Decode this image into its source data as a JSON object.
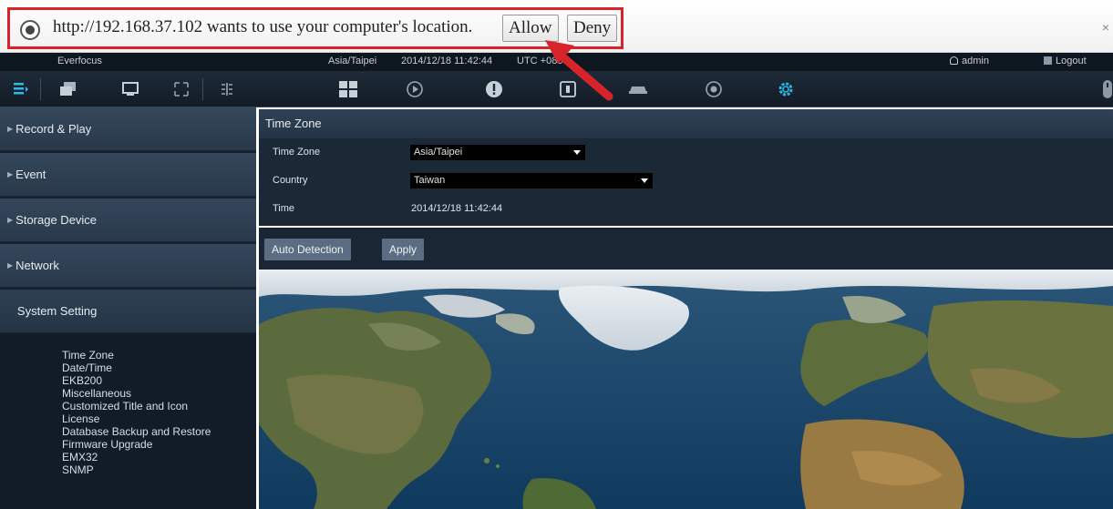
{
  "infobar": {
    "message": "http://192.168.37.102 wants to use your computer's location.",
    "allow_label": "Allow",
    "deny_label": "Deny",
    "close_glyph": "×"
  },
  "statusbar": {
    "brand": "Everfocus",
    "timezone": "Asia/Taipei",
    "datetime": "2014/12/18 11:42:44",
    "utc": "UTC +0800",
    "user": "admin",
    "logout": "Logout"
  },
  "toolbar": {
    "left_icons": [
      "list-icon",
      "layers-icon",
      "monitor-icon",
      "fullscreen-icon",
      "grid-split-icon"
    ],
    "center_icons": [
      "layout-grid-icon",
      "playback-icon",
      "alert-icon",
      "lock-icon",
      "car-icon",
      "disk-icon",
      "settings-icon"
    ],
    "right_icon": "mouse-icon",
    "active_icon": "settings-icon",
    "accent_color": "#29b6e6"
  },
  "sidebar": {
    "items": [
      {
        "label": "Record & Play"
      },
      {
        "label": "Event"
      },
      {
        "label": "Storage Device"
      },
      {
        "label": "Network"
      },
      {
        "label": "System Setting"
      }
    ],
    "sub_items": [
      "Time Zone",
      "Date/Time",
      "EKB200",
      "Miscellaneous",
      "Customized Title and Icon",
      "License",
      "Database Backup and Restore",
      "Firmware Upgrade",
      "EMX32",
      "SNMP"
    ]
  },
  "main": {
    "title": "Time Zone",
    "fields": {
      "timezone_label": "Time Zone",
      "timezone_value": "Asia/Taipei",
      "country_label": "Country",
      "country_value": "Taiwan",
      "time_label": "Time",
      "time_value": "2014/12/18 11:42:44"
    },
    "auto_detection_label": "Auto Detection",
    "apply_label": "Apply"
  },
  "colors": {
    "highlight_red": "#d6242a",
    "panel_dark": "#1b2836"
  }
}
